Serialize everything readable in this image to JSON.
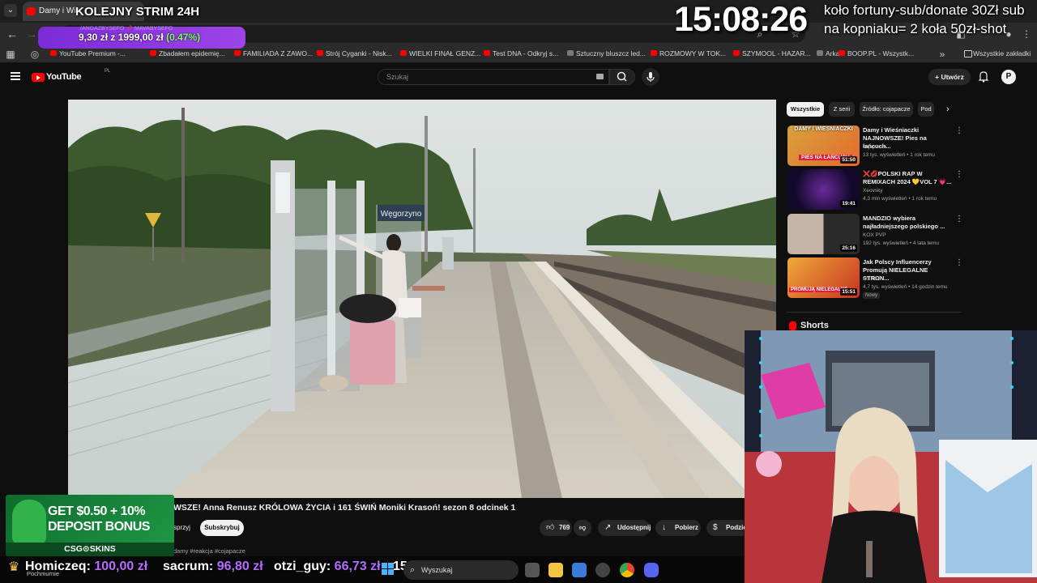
{
  "browser": {
    "tab_title": "Damy i Wie",
    "address_ghost": "youtube.com/watch?v=...",
    "bookmarks": [
      "YouTube Premium -...",
      "Zbadałem epidemię...",
      "FAMILIADA Z ZAWO...",
      "Strój Cyganki - Nisk...",
      "WIELKI FINAŁ GENZ...",
      "Test DNA - Odkryj s...",
      "Sztuczny bluszcz led...",
      "ROZMOWY W TOK...",
      "SZYMOOL - HAZAR...",
      "Arka",
      "BOOP.PL - Wszystk..."
    ],
    "all_bookmarks": "Wszystkie zakładki"
  },
  "youtube": {
    "logo": "YouTube",
    "logo_region": "PL",
    "search_placeholder": "Szukaj",
    "create_label": "Utwórz",
    "avatar_letter": "P"
  },
  "sidebar": {
    "chips": [
      "Wszystkie",
      "Z serii",
      "Źródło: cojapacze",
      "Pod"
    ],
    "recommendations": [
      {
        "title": "Damy i Wieśniaczki NAJNOWSZE! Pies na łańcuch...",
        "channel": "cojapacze",
        "meta": "13 tys. wyświetleń • 1 rok temu",
        "duration": "51:50",
        "thumb_text": "DAMY I WIEŚNIACZKI",
        "thumb_sub": "PIES NA ŁAŃCUCH"
      },
      {
        "title": "❌💋POLSKI RAP W REMIXACH 2024 💛VOL 7 💗...",
        "channel": "Xeovsky",
        "meta": "4,3 mln wyświetleń • 1 rok temu",
        "duration": "19:41",
        "thumb_text": "",
        "thumb_sub": ""
      },
      {
        "title": "MANDZIO wybiera najładniejszego polskiego ...",
        "channel": "KOX PVP",
        "meta": "192 tys. wyświetleń • 4 lata temu",
        "duration": "25:16",
        "thumb_text": "",
        "thumb_sub": ""
      },
      {
        "title": "Jak Polscy Influencerzy Promują NIELEGALNE STRON...",
        "channel": "OSKEE",
        "meta": "4,7 tys. wyświetleń • 14 godzin temu",
        "duration": "15:51",
        "thumb_text": "PROMUJĄ NIELEGALNE",
        "thumb_sub": "",
        "badge": "Nowy"
      }
    ],
    "shorts_label": "Shorts"
  },
  "video": {
    "sign_text": "Węgorzyno",
    "title_visible": "WSZE! Anna Renusz KRÓLOWA ŻYCIA i 161 ŚWIŃ Moniki Krasoń! sezon 8 odcinek 1",
    "sponsor_label": "sprzyj",
    "subscribe_label": "Subskrybuj",
    "likes": "769",
    "share_label": "Udostępnij",
    "download_label": "Pobierz",
    "thanks_label": "Podzięk",
    "description_visible": "damy #reakcja #cojapacze"
  },
  "overlay": {
    "stream_title": "KOLEJNY STRIM 24H",
    "clock": "15:08:26",
    "donate_text": "koło fortuny-sub/donate 30Zł sub na kopniaku= 2 koła 50zł-shot",
    "goal_amount": "9,30 zł",
    "goal_of": "z 1999,00 zł",
    "goal_pct": "(0.47%)",
    "goal_ghost": "/ANGAZBYSEFO 📌 MAVABYSEFO",
    "ad_line1": "GET $0.50 + 10%",
    "ad_line2": "DEPOSIT BONUS",
    "ad_brand": "CSG⊙SKINS",
    "ticker": [
      {
        "name": "Homiczeq:",
        "amount": "100,00 zł"
      },
      {
        "name": "sacrum:",
        "amount": "96,80 zł"
      },
      {
        "name": "otzi_guy:",
        "amount": "66,73 zł"
      }
    ],
    "ticker_tail": "15,5",
    "ticker_sub": "Pochmurnie"
  },
  "taskbar": {
    "search_label": "Wyszukaj"
  },
  "colors": {
    "yt_red": "#ff0000",
    "goal_purple": "#8a36df",
    "ticker_amount": "#b56cff",
    "goal_pct_green": "#7dff6a"
  }
}
